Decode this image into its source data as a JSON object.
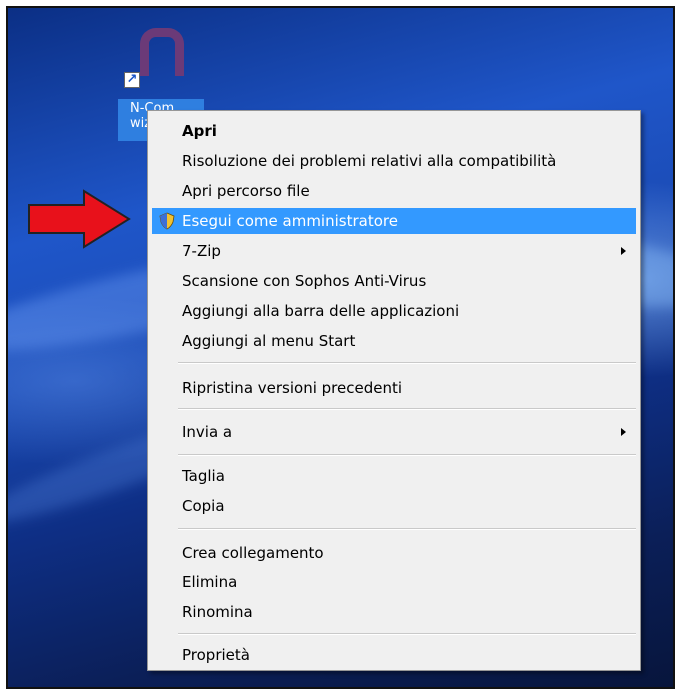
{
  "desktop": {
    "icon_label_line1": "N-Com",
    "icon_label_line2": "wiz",
    "shortcut_glyph": "↗",
    "colors": {
      "icon_logo": "#6b3a78",
      "icon_label_bg": "#2f7fe0",
      "arrow_fill": "#e8111b"
    }
  },
  "context_menu": {
    "highlight_color": "#3399ff",
    "items": [
      {
        "label": "Apri",
        "bold": true
      },
      {
        "label": "Risoluzione dei problemi relativi alla compatibilità"
      },
      {
        "label": "Apri percorso file"
      },
      {
        "label": "Esegui come amministratore",
        "icon": "uac-shield-icon",
        "highlighted": true
      },
      {
        "label": "7-Zip",
        "submenu": true
      },
      {
        "label": "Scansione con Sophos Anti-Virus"
      },
      {
        "label": "Aggiungi alla barra delle applicazioni"
      },
      {
        "label": "Aggiungi al menu Start"
      },
      {
        "label": "Ripristina versioni precedenti"
      },
      {
        "label": "Invia a",
        "submenu": true
      },
      {
        "label": "Taglia"
      },
      {
        "label": "Copia"
      },
      {
        "label": "Crea collegamento"
      },
      {
        "label": "Elimina"
      },
      {
        "label": "Rinomina"
      },
      {
        "label": "Proprietà"
      }
    ]
  }
}
